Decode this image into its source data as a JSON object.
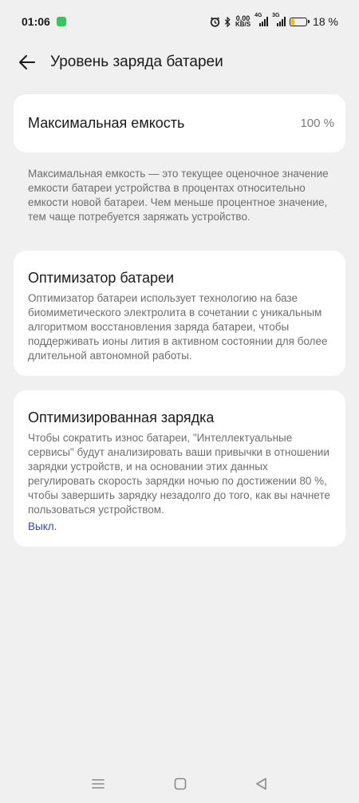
{
  "status": {
    "time": "01:06",
    "net_speed_value": "0,00",
    "net_speed_unit": "KB/S",
    "net1_label": "4G",
    "net2_label": "3G",
    "battery_percent": "18 %"
  },
  "header": {
    "title": "Уровень заряда батареи"
  },
  "capacity": {
    "label": "Максимальная емкость",
    "value": "100 %"
  },
  "capacity_description": "Максимальная емкость — это текущее оценочное значение емкости батареи устройства в процентах относительно емкости новой батареи. Чем меньше процентное значение, тем чаще потребуется заряжать устройство.",
  "optimizer": {
    "title": "Оптимизатор батареи",
    "body": "Оптимизатор батареи использует технологию на базе биомиметического электролита в сочетании с уникальным алгоритмом восстановления заряда батареи, чтобы поддерживать ионы лития в активном состоянии для более длительной автономной работы."
  },
  "optimized_charging": {
    "title": "Оптимизированная зарядка",
    "body": "Чтобы сократить износ батареи, \"Интеллектуальные сервисы\" будут анализировать ваши привычки в отношении зарядки устройств, и на основании этих данных регулировать скорость зарядки ночью по достижении 80 %, чтобы завершить зарядку незадолго до того, как вы начнете пользоваться устройством.",
    "status": "Выкл."
  },
  "colors": {
    "background": "#f0f0f0",
    "card": "#ffffff",
    "link": "#2f4bb8",
    "battery_fill": "#f5b800"
  }
}
